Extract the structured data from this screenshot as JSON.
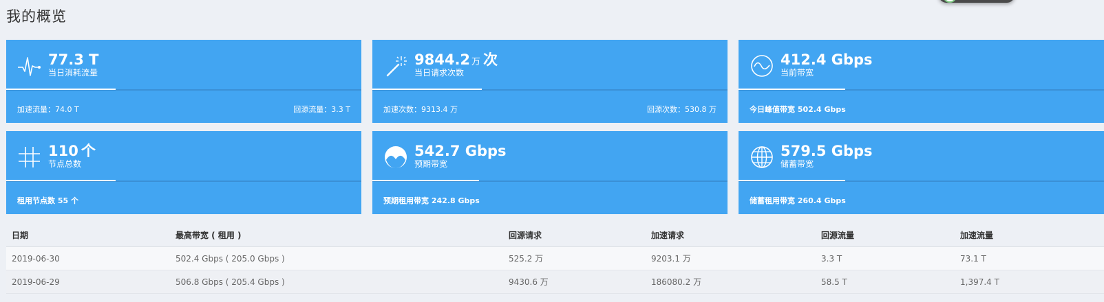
{
  "page": {
    "title": "我的概览"
  },
  "colors": {
    "card_bg": "#42a5f2",
    "page_bg": "#edf0f5"
  },
  "cards": [
    {
      "icon": "pulse-icon",
      "value": "77.3 T",
      "label": "当日消耗流量",
      "foot_left": "加速流量：74.0 T",
      "foot_right": "回源流量：3.3 T"
    },
    {
      "icon": "magic-wand-icon",
      "value": "9844.2",
      "unit_small": "万",
      "unit_big": "次",
      "label": "当日请求次数",
      "foot_left": "加速次数：9313.4 万",
      "foot_right": "回源次数：530.8 万"
    },
    {
      "icon": "wave-circle-icon",
      "value": "412.4 Gbps",
      "label": "当前带宽",
      "foot_left": "今日峰值带宽 502.4 Gbps"
    },
    {
      "icon": "hashtag-icon",
      "value": "110",
      "unit_big": "个",
      "label": "节点总数",
      "foot_left": "租用节点数 55 个"
    },
    {
      "icon": "mountain-circle-icon",
      "value": "542.7 Gbps",
      "label": "预期带宽",
      "foot_left": "预期租用带宽 242.8 Gbps"
    },
    {
      "icon": "globe-icon",
      "value": "579.5 Gbps",
      "label": "储蓄带宽",
      "foot_left": "储蓄租用带宽 260.4 Gbps"
    }
  ],
  "table": {
    "headers": [
      "日期",
      "最高带宽 ( 租用 )",
      "回源请求",
      "加速请求",
      "回源流量",
      "加速流量"
    ],
    "rows": [
      [
        "2019-06-30",
        "502.4 Gbps ( 205.0 Gbps )",
        "525.2 万",
        "9203.1 万",
        "3.3 T",
        "73.1 T"
      ],
      [
        "2019-06-29",
        "506.8 Gbps ( 205.4 Gbps )",
        "9430.6 万",
        "186080.2 万",
        "58.5 T",
        "1,397.4 T"
      ]
    ]
  }
}
